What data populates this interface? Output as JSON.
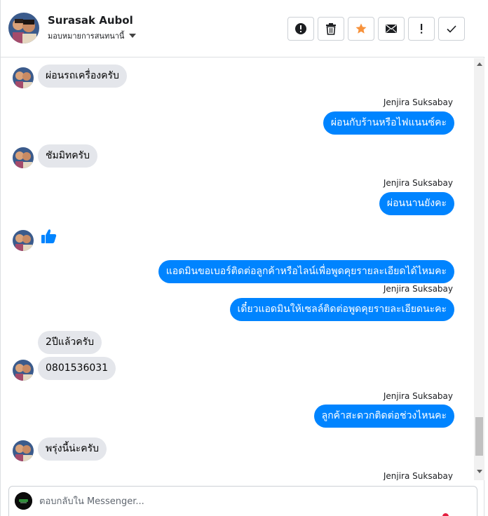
{
  "header": {
    "contact_name": "Surasak Aubol",
    "assign_label": "มอบหมายการสนทนานี้",
    "actions": [
      {
        "name": "mark-spam-button",
        "icon": "alert-circle-icon"
      },
      {
        "name": "delete-button",
        "icon": "trash-icon"
      },
      {
        "name": "star-button",
        "icon": "star-icon"
      },
      {
        "name": "mark-unread-button",
        "icon": "envelope-icon"
      },
      {
        "name": "follow-up-button",
        "icon": "exclamation-icon"
      },
      {
        "name": "mark-done-button",
        "icon": "check-icon"
      }
    ]
  },
  "thread": {
    "messages": [
      {
        "direction": "in",
        "text": "ผ่อนรถเครื่องครับ"
      },
      {
        "direction": "out",
        "sender": "Jenjira Suksabay",
        "text": "ผ่อนกับร้านหรือไฟแนนซ์คะ"
      },
      {
        "direction": "in",
        "text": "ชัมมิทครับ"
      },
      {
        "direction": "out",
        "sender": "Jenjira Suksabay",
        "text": "ผ่อนนานยังคะ"
      },
      {
        "direction": "in",
        "type": "like",
        "icon": "thumbs-up-icon"
      },
      {
        "direction": "out",
        "text": "แอดมินขอเบอร์ติดต่อลูกค้าหรือไลน์เพื่อพูดคุยรายละเอียดได้ไหมคะ"
      },
      {
        "direction": "out",
        "sender": "Jenjira Suksabay",
        "text": "เดี๋ยวแอดมินให้เซลล์ติดต่อพูดคุยรายละเอียดนะคะ"
      },
      {
        "direction": "in",
        "text": "2ปีแล้วครับ"
      },
      {
        "direction": "in",
        "text": "0801536031"
      },
      {
        "direction": "out",
        "sender": "Jenjira Suksabay",
        "text": "ลูกค้าสะดวกติดต่อช่วงไหนคะ"
      },
      {
        "direction": "in",
        "text": "พรุ่งนี้น่ะครับ"
      },
      {
        "direction": "out",
        "sender": "Jenjira Suksabay",
        "text": ""
      }
    ]
  },
  "composer": {
    "placeholder": "ตอบกลับใน Messenger..."
  },
  "colors": {
    "outgoing_bubble": "#0084ff",
    "incoming_bubble": "#e4e6eb",
    "star_accent": "#f7923b",
    "like_blue": "#0084ff"
  }
}
